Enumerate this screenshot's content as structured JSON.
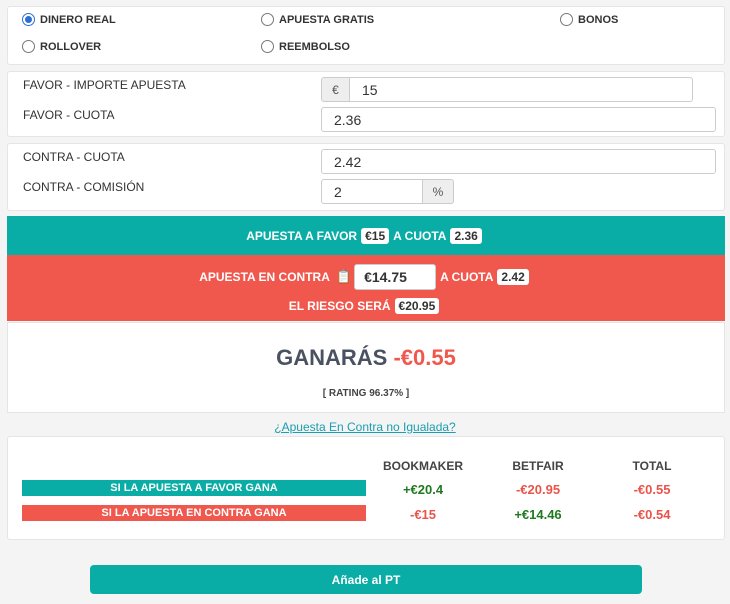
{
  "bet_types": [
    {
      "label": "DINERO REAL",
      "checked": true
    },
    {
      "label": "APUESTA GRATIS",
      "checked": false
    },
    {
      "label": "BONOS",
      "checked": false
    },
    {
      "label": "ROLLOVER",
      "checked": false
    },
    {
      "label": "REEMBOLSO",
      "checked": false
    }
  ],
  "favor": {
    "stake_label": "FAVOR - IMPORTE APUESTA",
    "currency": "€",
    "stake_value": "15",
    "odds_label": "FAVOR - CUOTA",
    "odds_value": "2.36"
  },
  "contra": {
    "odds_label": "CONTRA - CUOTA",
    "odds_value": "2.42",
    "commission_label": "CONTRA - COMISIÓN",
    "commission_value": "2",
    "percent": "%"
  },
  "favor_band": {
    "text1": "APUESTA A FAVOR",
    "stake": "€15",
    "text2": "A CUOTA",
    "odds": "2.36"
  },
  "contra_band": {
    "text1": "APUESTA EN CONTRA",
    "stake": "€14.75",
    "text2": "A CUOTA",
    "odds": "2.42",
    "risk_text": "EL RIESGO SERÁ",
    "risk": "€20.95"
  },
  "result": {
    "win_label": "GANARÁS",
    "win_value": "-€0.55",
    "rating": "[ RATING 96.37% ]"
  },
  "unmatched_link": "¿Apuesta En Contra no Igualada?",
  "table": {
    "headers": [
      "BOOKMAKER",
      "BETFAIR",
      "TOTAL"
    ],
    "rows": [
      {
        "label": "SI LA APUESTA A FAVOR GANA",
        "values": [
          "+€20.4",
          "-€20.95",
          "-€0.55"
        ]
      },
      {
        "label": "SI LA APUESTA EN CONTRA GANA",
        "values": [
          "-€15",
          "+€14.46",
          "-€0.54"
        ]
      }
    ]
  },
  "add_button": "Añade al PT",
  "colors": {
    "teal": "#0aada6",
    "red": "#f0574d",
    "positive": "#1f7a1f",
    "negative": "#e8544a"
  }
}
